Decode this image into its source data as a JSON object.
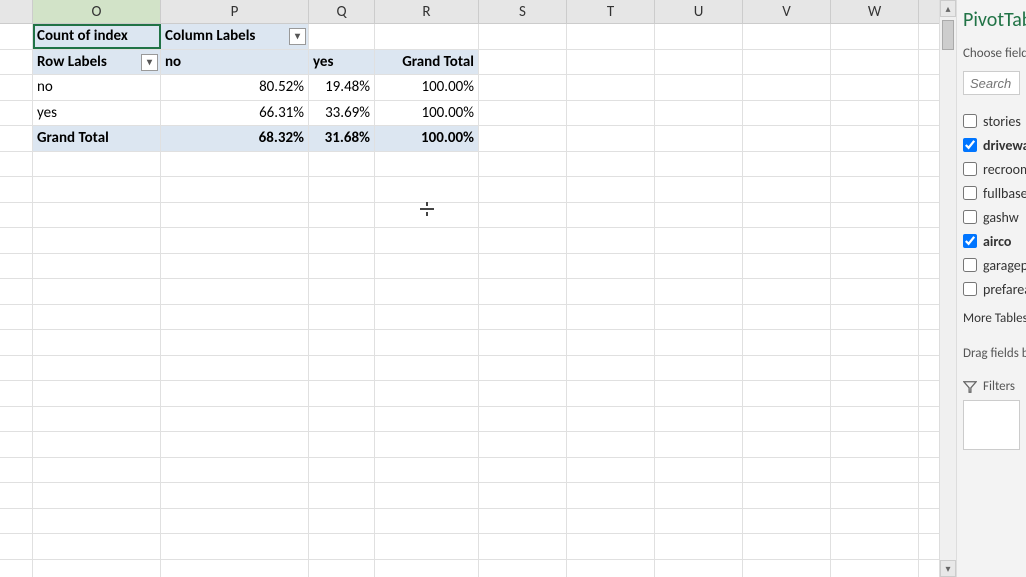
{
  "columns": [
    "O",
    "P",
    "Q",
    "R",
    "S",
    "T",
    "U",
    "V",
    "W"
  ],
  "pivot": {
    "count_label": "Count of index",
    "column_labels_label": "Column Labels",
    "row_labels_label": "Row Labels",
    "col_headers": [
      "no",
      "yes",
      "Grand Total"
    ],
    "rows": [
      {
        "label": "no",
        "values": [
          "80.52%",
          "19.48%",
          "100.00%"
        ]
      },
      {
        "label": "yes",
        "values": [
          "66.31%",
          "33.69%",
          "100.00%"
        ]
      }
    ],
    "grand_total_label": "Grand Total",
    "grand_total_values": [
      "68.32%",
      "31.68%",
      "100.00%"
    ]
  },
  "panel": {
    "title": "PivotTable Fields",
    "choose_label": "Choose fields to add to report:",
    "search_placeholder": "Search",
    "fields": [
      {
        "name": "stories",
        "checked": false
      },
      {
        "name": "driveway",
        "checked": true
      },
      {
        "name": "recroom",
        "checked": false
      },
      {
        "name": "fullbase",
        "checked": false
      },
      {
        "name": "gashw",
        "checked": false
      },
      {
        "name": "airco",
        "checked": true
      },
      {
        "name": "garagepl",
        "checked": false
      },
      {
        "name": "prefarea",
        "checked": false
      }
    ],
    "more_tables": "More Tables...",
    "drag_label": "Drag fields between areas below:",
    "filters_label": "Filters"
  }
}
